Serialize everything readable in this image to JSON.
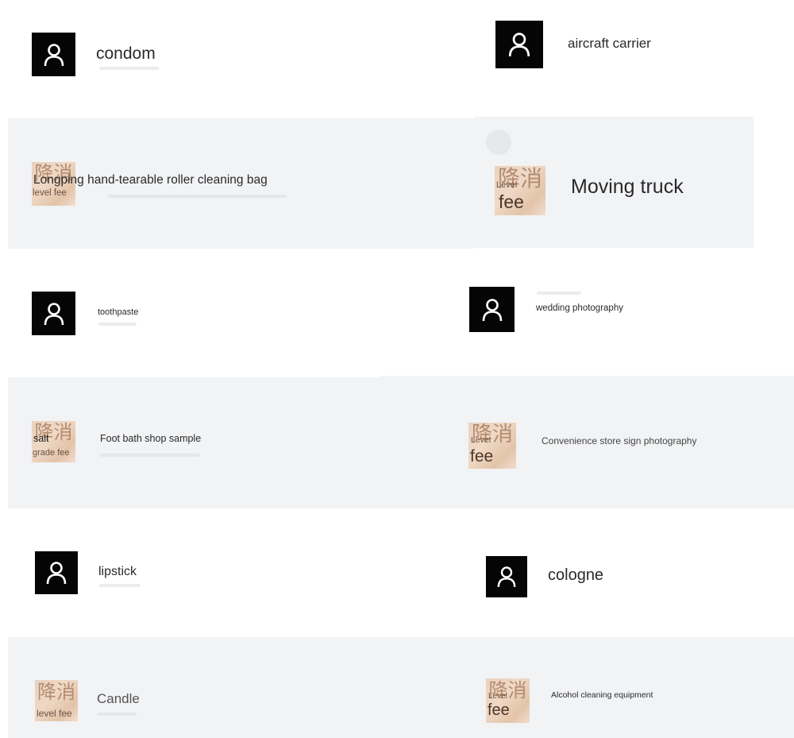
{
  "icons": {
    "avatar": "user-icon"
  },
  "colors": {
    "row_gray": "#f2f3f5",
    "row_white": "#ffffff",
    "avatar_bg": "#050505",
    "fee_thumb_bg": "#e9d2bf"
  },
  "thumb_text": {
    "jiang_xiao": "降消"
  },
  "items": [
    {
      "title": "condom",
      "thumb": "avatar"
    },
    {
      "title": "aircraft carrier",
      "thumb": "avatar"
    },
    {
      "title": "Longping hand-tearable roller cleaning bag",
      "thumb": "fee",
      "fee_label": "level fee"
    },
    {
      "title": "Moving truck",
      "thumb": "fee",
      "fee_label": "Level",
      "fee_big": "fee"
    },
    {
      "title": "toothpaste",
      "thumb": "avatar"
    },
    {
      "title": "wedding photography",
      "thumb": "avatar"
    },
    {
      "title": "Foot bath shop sample",
      "thumb": "fee",
      "fee_label": "salt",
      "fee_sub": "grade fee"
    },
    {
      "title": "Convenience store sign photography",
      "thumb": "fee",
      "fee_label": "Level",
      "fee_big": "fee"
    },
    {
      "title": "lipstick",
      "thumb": "avatar"
    },
    {
      "title": "cologne",
      "thumb": "avatar"
    },
    {
      "title": "Candle",
      "thumb": "fee",
      "fee_label": "level fee"
    },
    {
      "title": "Alcohol cleaning equipment",
      "thumb": "fee",
      "fee_label": "Level",
      "fee_big": "fee"
    }
  ]
}
